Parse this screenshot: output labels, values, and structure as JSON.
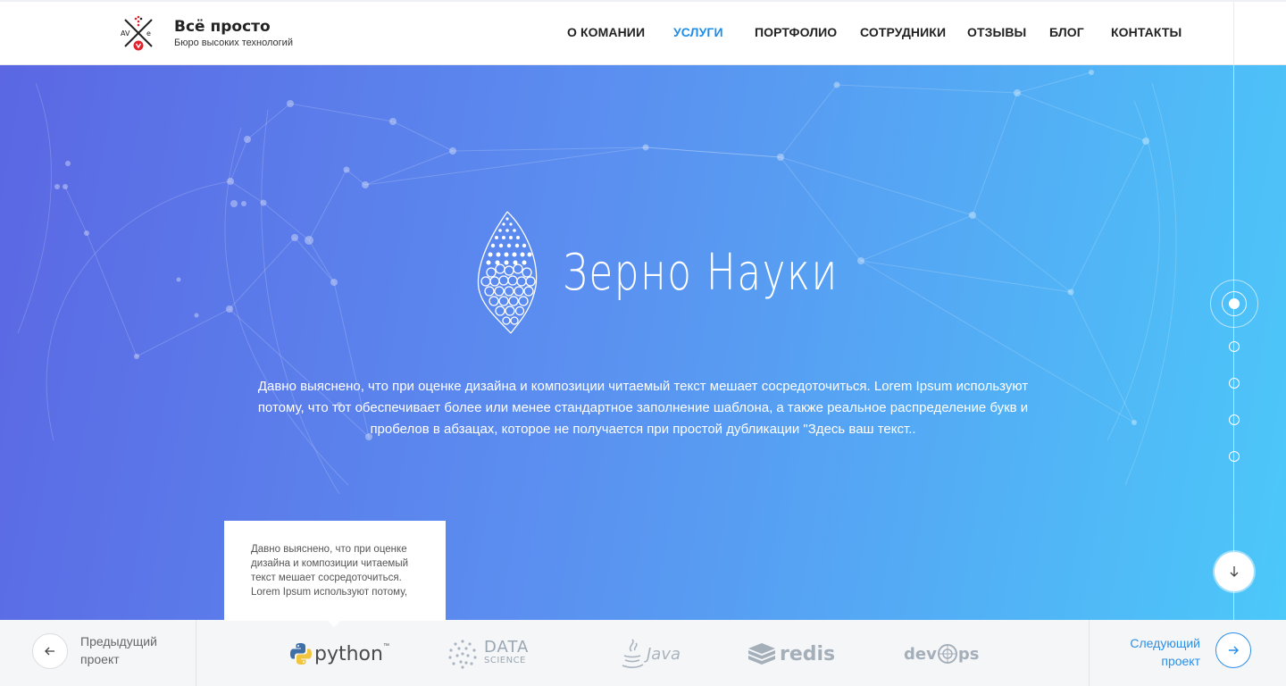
{
  "header": {
    "logo_title": "Всё просто",
    "logo_subtitle": "Бюро высоких технологий",
    "logo_mark_text": "AV e",
    "nav": [
      {
        "label": "О КОМАНИИ",
        "active": false
      },
      {
        "label": "УСЛУГИ",
        "active": true
      },
      {
        "label": "ПОРТФОЛИО",
        "active": false
      },
      {
        "label": "СОТРУДНИКИ",
        "active": false
      },
      {
        "label": "ОТЗЫВЫ",
        "active": false
      },
      {
        "label": "БЛОГ",
        "active": false
      },
      {
        "label": "КОНТАКТЫ",
        "active": false
      }
    ]
  },
  "hero": {
    "brand_name": "Зерно Науки",
    "description": "Давно выяснено, что при оценке дизайна и композиции читаемый текст мешает сосредоточиться. Lorem Ipsum используют потому, что тот обеспечивает более или менее стандартное заполнение шаблона, а также реальное распределение букв и пробелов в абзацах, которое не получается при простой дубликации \"Здесь ваш текст..",
    "slides_total": 5,
    "slide_active": 1,
    "scroll_icon": "arrow-down-icon"
  },
  "tooltip": {
    "text": "Давно выяснено, что при оценке дизайна и композиции читаемый текст мешает сосредоточиться. Lorem Ipsum используют потому,"
  },
  "footer": {
    "prev_label_1": "Предыдущий",
    "prev_label_2": "проект",
    "next_label_1": "Следующий",
    "next_label_2": "проект",
    "prev_icon": "arrow-left-icon",
    "next_icon": "arrow-right-icon",
    "technologies": [
      {
        "name": "python",
        "icon": "python-logo-icon",
        "tm": "™"
      },
      {
        "name_1": "DATA",
        "name_2": "SCIENCE",
        "icon": "data-science-logo-icon"
      },
      {
        "name": "Java",
        "icon": "java-logo-icon"
      },
      {
        "name": "redis",
        "icon": "redis-logo-icon"
      },
      {
        "name_1": "dev",
        "name_2": "ps",
        "icon": "devops-logo-icon"
      }
    ]
  },
  "colors": {
    "accent": "#1e8de8",
    "hero_gradient_start": "#5b67e3",
    "hero_gradient_end": "#4cc8f9",
    "footer_bg": "#f5f6f8"
  }
}
